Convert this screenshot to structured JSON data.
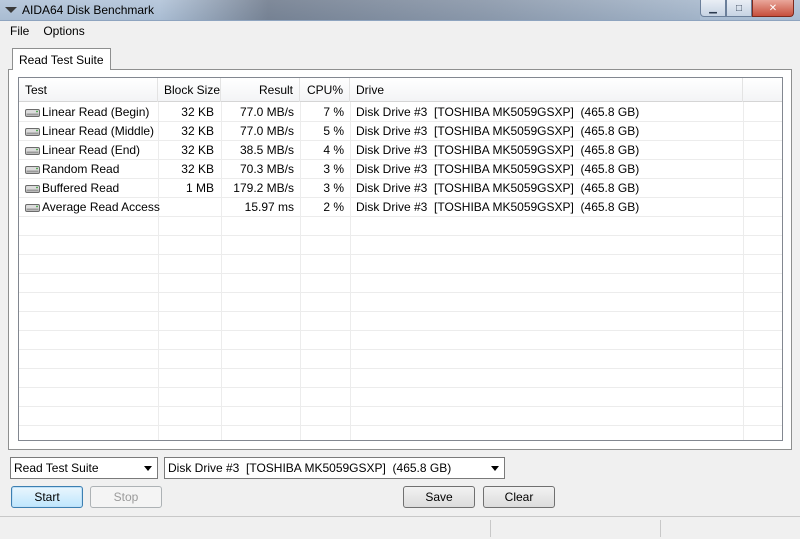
{
  "window": {
    "title": "AIDA64 Disk Benchmark",
    "controls": {
      "minimize": "▁",
      "maximize": "□",
      "close": "✕"
    }
  },
  "menu": {
    "items": [
      "File",
      "Options"
    ]
  },
  "tabs": [
    {
      "label": "Read Test Suite"
    }
  ],
  "table": {
    "columns": [
      "Test",
      "Block Size",
      "Result",
      "CPU%",
      "Drive"
    ],
    "rows": [
      {
        "test": "Linear Read (Begin)",
        "block_size": "32 KB",
        "result": "77.0 MB/s",
        "cpu": "7 %",
        "drive": "Disk Drive #3  [TOSHIBA MK5059GSXP]  (465.8 GB)"
      },
      {
        "test": "Linear Read (Middle)",
        "block_size": "32 KB",
        "result": "77.0 MB/s",
        "cpu": "5 %",
        "drive": "Disk Drive #3  [TOSHIBA MK5059GSXP]  (465.8 GB)"
      },
      {
        "test": "Linear Read (End)",
        "block_size": "32 KB",
        "result": "38.5 MB/s",
        "cpu": "4 %",
        "drive": "Disk Drive #3  [TOSHIBA MK5059GSXP]  (465.8 GB)"
      },
      {
        "test": "Random Read",
        "block_size": "32 KB",
        "result": "70.3 MB/s",
        "cpu": "3 %",
        "drive": "Disk Drive #3  [TOSHIBA MK5059GSXP]  (465.8 GB)"
      },
      {
        "test": "Buffered Read",
        "block_size": "1 MB",
        "result": "179.2 MB/s",
        "cpu": "3 %",
        "drive": "Disk Drive #3  [TOSHIBA MK5059GSXP]  (465.8 GB)"
      },
      {
        "test": "Average Read Access",
        "block_size": "",
        "result": "15.97 ms",
        "cpu": "2 %",
        "drive": "Disk Drive #3  [TOSHIBA MK5059GSXP]  (465.8 GB)"
      }
    ],
    "row_icon": "hard-drive-icon"
  },
  "controls": {
    "suite_select": "Read Test Suite",
    "drive_select": "Disk Drive #3  [TOSHIBA MK5059GSXP]  (465.8 GB)",
    "start_label": "Start",
    "stop_label": "Stop",
    "save_label": "Save",
    "clear_label": "Clear"
  },
  "colors": {
    "accent": "#3c7fb1",
    "titlebar": "#b9c9dc",
    "close": "#c74f3c"
  }
}
